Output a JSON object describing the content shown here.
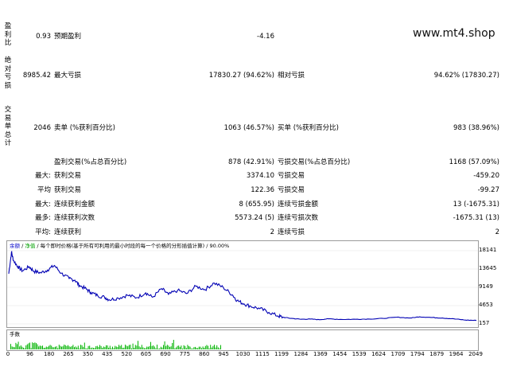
{
  "watermark": "www.mt4.shop",
  "vlabels": {
    "profit_ratio": [
      "盈",
      "利",
      "比"
    ],
    "absolute_loss": [
      "绝",
      "对",
      "亏",
      "损"
    ],
    "trade_summary": [
      "交",
      "易",
      "单",
      "总",
      "计"
    ]
  },
  "rows": {
    "profit_ratio_value": "0.93",
    "expected_payoff_label": "预期盈利",
    "expected_payoff_value": "-4.16",
    "absolute_loss_value": "8985.42",
    "max_drawdown_label": "最大亏损",
    "max_drawdown_value": "17830.27 (94.62%)",
    "relative_drawdown_label": "相对亏损",
    "relative_drawdown_value": "94.62% (17830.27)",
    "total_trades_value": "2046",
    "short_label": "卖单 (%获利百分比)",
    "short_value": "1063 (46.57%)",
    "long_label": "买单 (%获利百分比)",
    "long_value": "983 (38.96%)",
    "profit_trades_label": "盈利交易(%占总百分比)",
    "profit_trades_value": "878 (42.91%)",
    "loss_trades_label": "亏损交易(%占总百分比)",
    "loss_trades_value": "1168 (57.09%)",
    "largest_prefix": "最大:",
    "largest_profit_label": "获利交易",
    "largest_profit_value": "3374.10",
    "largest_loss_label": "亏损交易",
    "largest_loss_value": "-459.20",
    "average_prefix": "平均",
    "average_profit_label": "获利交易",
    "average_profit_value": "122.36",
    "average_loss_label": "亏损交易",
    "average_loss_value": "-99.27",
    "max_consec_prefix": "最大:",
    "max_consec_wins_label": "连续获利金额",
    "max_consec_wins_value": "8 (655.95)",
    "max_consec_losses_label": "连续亏损金额",
    "max_consec_losses_value": "13 (-1675.31)",
    "maximal_prefix": "最多:",
    "maximal_profit_label": "连续获利次数",
    "maximal_profit_value": "5573.24 (5)",
    "maximal_loss_label": "连续亏损次数",
    "maximal_loss_value": "-1675.31 (13)",
    "avg_consec_prefix": "平均:",
    "avg_consec_wins_label": "连续获利",
    "avg_consec_wins_value": "2",
    "avg_consec_losses_label": "连续亏损",
    "avg_consec_losses_value": "2"
  },
  "chart": {
    "legend_balance": "余额",
    "legend_sep1": " / ",
    "legend_equity": "净值",
    "legend_rest": " / 每个即时价格(基于所有可利用的最小时段的每一个价格的分形插值计算) / 90.00%",
    "volume_label": "手数",
    "balance_color": "#0000b4",
    "volume_color": "#00b400"
  },
  "chart_data": {
    "type": "line",
    "series": [
      {
        "values_x": [
          0,
          12,
          20,
          40,
          60,
          90,
          110,
          140,
          170,
          200,
          230,
          265,
          290,
          310,
          340,
          360,
          390,
          420,
          440,
          480,
          520,
          560,
          600,
          630,
          670,
          700,
          740,
          780,
          820,
          860,
          900,
          940,
          980,
          1000,
          1030,
          1060,
          1100,
          1140,
          1180,
          1200,
          1240,
          1280,
          1320,
          1360,
          1400,
          1460,
          1520,
          1580,
          1640,
          1700,
          1760,
          1800,
          1850,
          1900,
          1950,
          2000,
          2049
        ],
        "values_y": [
          12500,
          17800,
          15800,
          14200,
          13200,
          14200,
          13100,
          12700,
          13400,
          14500,
          12600,
          11300,
          10900,
          9600,
          8700,
          7900,
          7100,
          6700,
          6100,
          6500,
          7200,
          6600,
          7800,
          6700,
          8800,
          7400,
          8400,
          7600,
          9400,
          8600,
          10200,
          9100,
          7300,
          5900,
          5100,
          4500,
          3900,
          3000,
          2100,
          1800,
          1500,
          1300,
          1350,
          1200,
          1400,
          1250,
          1300,
          1350,
          1500,
          1800,
          1600,
          1900,
          1750,
          1600,
          1400,
          1100,
          1000
        ]
      }
    ],
    "y_ticks": [
      "18141",
      "13645",
      "9149",
      "4653",
      "157"
    ],
    "x_ticks": [
      "0",
      "96",
      "180",
      "265",
      "350",
      "435",
      "520",
      "605",
      "690",
      "775",
      "860",
      "945",
      "1030",
      "1115",
      "1199",
      "1284",
      "1369",
      "1454",
      "1539",
      "1624",
      "1709",
      "1794",
      "1879",
      "1964",
      "2049"
    ],
    "ylim": [
      157,
      18141
    ],
    "xlim": [
      0,
      2049
    ]
  }
}
